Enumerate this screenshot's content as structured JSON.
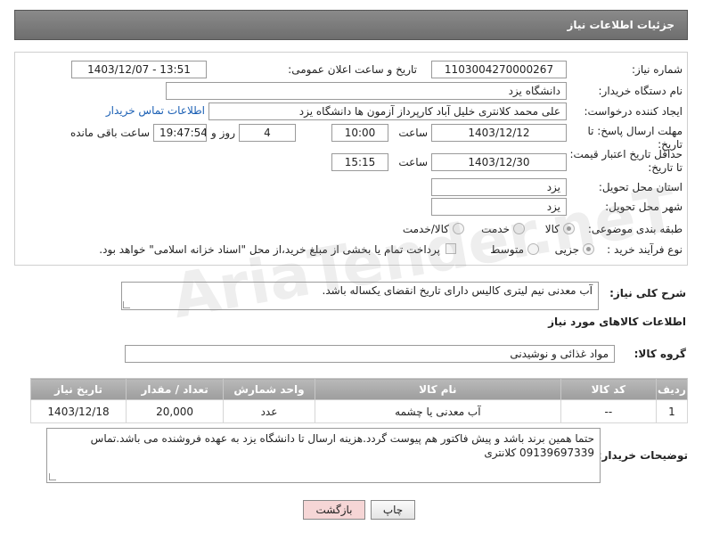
{
  "header": {
    "title": "جزئیات اطلاعات نیاز"
  },
  "form": {
    "need_number_label": "شماره نیاز:",
    "need_number": "1103004270000267",
    "announce_label": "تاریخ و ساعت اعلان عمومی:",
    "announce_value": "1403/12/07 - 13:51",
    "buyer_org_label": "نام دستگاه خریدار:",
    "buyer_org": "دانشگاه یزد",
    "creator_label": "ایجاد کننده درخواست:",
    "creator": "علی محمد کلانتری خلیل آباد کارپرداز آزمون ها دانشگاه یزد",
    "contact_link": "اطلاعات تماس خریدار",
    "deadline_label": "مهلت ارسال پاسخ: تا تاریخ:",
    "deadline_date": "1403/12/12",
    "time_label": "ساعت",
    "deadline_time": "10:00",
    "days_value": "4",
    "days_label": "روز و",
    "remaining_time": "19:47:54",
    "remaining_label": "ساعت باقی مانده",
    "price_valid_label": "حداقل تاریخ اعتبار قیمت: تا تاریخ:",
    "price_valid_date": "1403/12/30",
    "price_valid_time": "15:15",
    "province_label": "استان محل تحویل:",
    "province": "یزد",
    "city_label": "شهر محل تحویل:",
    "city": "یزد",
    "category_label": "طبقه بندی موضوعی:",
    "category_options": [
      "کالا",
      "خدمت",
      "کالا/خدمت"
    ],
    "process_label": "نوع فرآیند خرید :",
    "process_options": [
      "جزیی",
      "متوسط"
    ],
    "payment_note": "پرداخت تمام یا بخشی از مبلغ خرید،از محل \"اسناد خزانه اسلامی\" خواهد بود."
  },
  "description": {
    "label": "شرح کلی نیاز:",
    "text": "آب معدنی نیم لیتری کالیس دارای تاریخ انقضای یکساله باشد."
  },
  "goods_section_title": "اطلاعات کالاهای مورد نیاز",
  "goods_group": {
    "label": "گروه کالا:",
    "value": "مواد غذائی و نوشیدنی"
  },
  "table": {
    "headers": [
      "ردیف",
      "کد کالا",
      "نام کالا",
      "واحد شمارش",
      "تعداد / مقدار",
      "تاریخ نیاز"
    ],
    "rows": [
      [
        "1",
        "--",
        "آب معدنی یا چشمه",
        "عدد",
        "20,000",
        "1403/12/18"
      ]
    ]
  },
  "buyer_notes": {
    "label": "توضیحات خریدار:",
    "text": "حتما همین برند باشد و پیش فاکتور هم پیوست گردد.هزینه ارسال تا دانشگاه یزد به عهده فروشنده می باشد.تماس 09139697339 کلانتری"
  },
  "buttons": {
    "print": "چاپ",
    "back": "بازگشت"
  },
  "watermark": "AriaTender.neT",
  "colors": {
    "header_bg": "#7a7a7a",
    "link": "#1a5fb4",
    "back_button": "#f6d6d6"
  }
}
